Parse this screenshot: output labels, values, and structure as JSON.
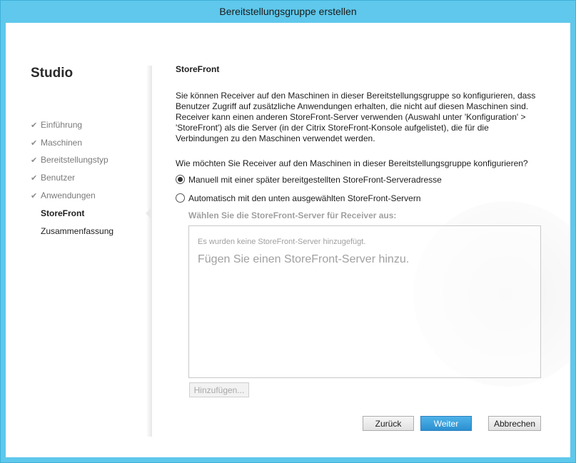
{
  "window": {
    "title": "Bereitstellungsgruppe erstellen"
  },
  "nav": {
    "app_title": "Studio",
    "steps": [
      {
        "label": "Einführung",
        "state": "done"
      },
      {
        "label": "Maschinen",
        "state": "done"
      },
      {
        "label": "Bereitstellungstyp",
        "state": "done"
      },
      {
        "label": "Benutzer",
        "state": "done"
      },
      {
        "label": "Anwendungen",
        "state": "done"
      },
      {
        "label": "StoreFront",
        "state": "current"
      },
      {
        "label": "Zusammenfassung",
        "state": "pending"
      }
    ],
    "check_icon": "✔"
  },
  "main": {
    "heading": "StoreFront",
    "description": "Sie können Receiver auf den Maschinen in dieser Bereitstellungsgruppe so konfigurieren, dass Benutzer Zugriff auf zusätzliche Anwendungen erhalten, die nicht auf diesen Maschinen sind. Receiver kann einen anderen StoreFront-Server verwenden (Auswahl unter 'Konfiguration' > 'StoreFront') als die Server (in der Citrix StoreFront-Konsole aufgelistet), die für die Verbindungen zu den Maschinen verwendet werden.",
    "question": "Wie möchten Sie Receiver auf den Maschinen in dieser Bereitstellungsgruppe konfigurieren?",
    "options": [
      {
        "label": "Manuell mit einer später bereitgestellten StoreFront-Serveradresse",
        "selected": true
      },
      {
        "label": "Automatisch mit den unten ausgewählten StoreFront-Servern",
        "selected": false
      }
    ],
    "server_list_label": "Wählen Sie die StoreFront-Server für Receiver aus:",
    "server_list_empty_small": "Es wurden keine StoreFront-Server hinzugefügt.",
    "server_list_empty_large": "Fügen Sie einen StoreFront-Server hinzu.",
    "add_button": "Hinzufügen..."
  },
  "footer": {
    "back_button": "Zurück",
    "next_button": "Weiter",
    "cancel_button": "Abbrechen"
  },
  "colors": {
    "titlebar": "#5fc8ec",
    "primary_button": "#2b8fd1"
  }
}
